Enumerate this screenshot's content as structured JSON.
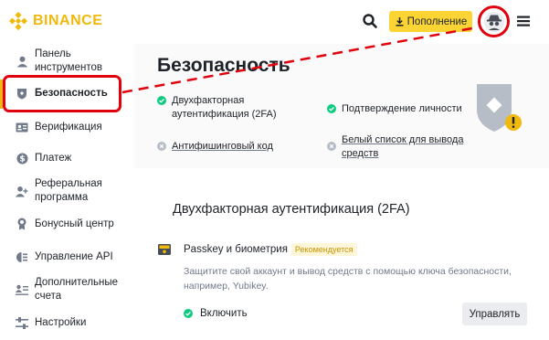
{
  "header": {
    "logo_text": "BINANCE",
    "deposit_label": "Пополнение",
    "brand_color": "#f0b90b",
    "deposit_color": "#fcd535"
  },
  "sidebar": {
    "items": [
      {
        "label": "Панель инструментов",
        "icon": "user-icon"
      },
      {
        "label": "Безопасность",
        "icon": "shield-icon",
        "active": true
      },
      {
        "label": "Верификация",
        "icon": "id-card-icon"
      },
      {
        "label": "Платеж",
        "icon": "dollar-icon"
      },
      {
        "label": "Реферальная программа",
        "label_lines": [
          "Реферальная",
          "программа"
        ],
        "icon": "user-plus-icon"
      },
      {
        "label": "Бонусный центр",
        "icon": "medal-icon"
      },
      {
        "label": "Управление API",
        "icon": "api-icon"
      },
      {
        "label": "Дополнительные счета",
        "label_lines": [
          "Дополнительные",
          "счета"
        ],
        "icon": "sub-accounts-icon"
      },
      {
        "label": "Настройки",
        "icon": "sliders-icon"
      }
    ]
  },
  "main": {
    "title": "Безопасность",
    "checks": {
      "twofa": {
        "lines": [
          "Двухфакторная",
          "аутентификация (2FA)"
        ],
        "status": "done"
      },
      "identity": {
        "label": "Подтверждение личности",
        "status": "done"
      },
      "antiphishing": {
        "label": "Антифишинговый код",
        "status": "pending"
      },
      "whitelist": {
        "lines": [
          "Белый список для вывода",
          "средств"
        ],
        "status": "pending"
      }
    },
    "section_title": "Двухфакторная аутентификация (2FA)",
    "method": {
      "title": "Passkey и биометрия",
      "badge": "Рекомендуется",
      "description": "Защитите свой аккаунт и вывод средств с помощью ключа безопасности, например, Yubikey.",
      "status": "Включить",
      "action": "Управлять"
    }
  },
  "colors": {
    "success": "#0ecb81",
    "pending": "#b7bdc6",
    "annotation": "#e0000e",
    "warning": "#f0b90b"
  }
}
